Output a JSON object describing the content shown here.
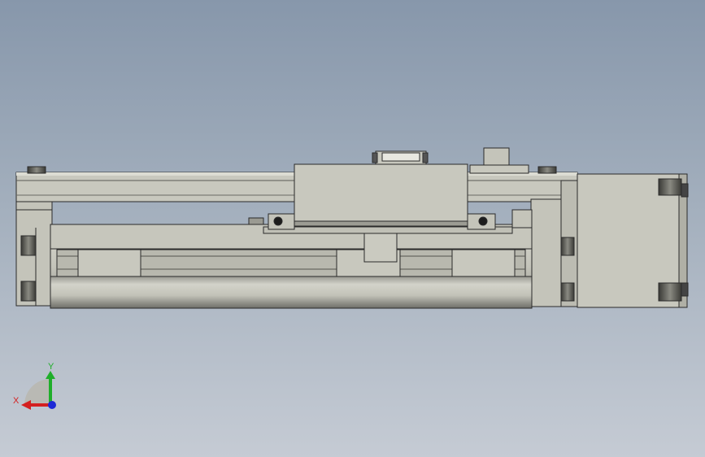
{
  "viewport": {
    "background_top": "#8797ab",
    "background_bottom": "#c5cbd4",
    "part_color": "#c6c6bc",
    "edge_color": "#2a2a2a"
  },
  "triad": {
    "x_label": "X",
    "y_label": "Y",
    "x_color": "#d42020",
    "y_color": "#1fae2a",
    "z_color": "#1d2ad6"
  }
}
